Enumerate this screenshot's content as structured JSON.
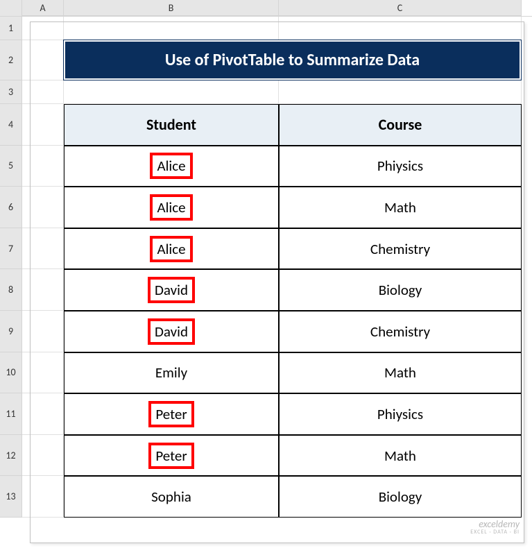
{
  "columns": {
    "a": "A",
    "b": "B",
    "c": "C"
  },
  "rows": [
    "1",
    "2",
    "3",
    "4",
    "5",
    "6",
    "7",
    "8",
    "9",
    "10",
    "11",
    "12",
    "13"
  ],
  "title": "Use of PivotTable to Summarize Data",
  "table": {
    "headers": {
      "student": "Student",
      "course": "Course"
    },
    "data": [
      {
        "student": "Alice",
        "course": "Phiysics",
        "highlight": true
      },
      {
        "student": "Alice",
        "course": "Math",
        "highlight": true
      },
      {
        "student": "Alice",
        "course": "Chemistry",
        "highlight": true
      },
      {
        "student": "David",
        "course": "Biology",
        "highlight": true
      },
      {
        "student": "David",
        "course": "Chemistry",
        "highlight": true
      },
      {
        "student": "Emily",
        "course": "Math",
        "highlight": false
      },
      {
        "student": "Peter",
        "course": "Phiysics",
        "highlight": true
      },
      {
        "student": "Peter",
        "course": "Math",
        "highlight": true
      },
      {
        "student": "Sophia",
        "course": "Biology",
        "highlight": false
      }
    ]
  },
  "watermark": {
    "main": "exceldemy",
    "sub": "EXCEL · DATA · BI"
  },
  "chart_data": {
    "type": "table",
    "title": "Use of PivotTable to Summarize Data",
    "columns": [
      "Student",
      "Course"
    ],
    "rows": [
      [
        "Alice",
        "Phiysics"
      ],
      [
        "Alice",
        "Math"
      ],
      [
        "Alice",
        "Chemistry"
      ],
      [
        "David",
        "Biology"
      ],
      [
        "David",
        "Chemistry"
      ],
      [
        "Emily",
        "Math"
      ],
      [
        "Peter",
        "Phiysics"
      ],
      [
        "Peter",
        "Math"
      ],
      [
        "Sophia",
        "Biology"
      ]
    ],
    "highlighted_rows_index": [
      0,
      1,
      2,
      3,
      4,
      6,
      7
    ],
    "highlighted_column": "Student"
  }
}
